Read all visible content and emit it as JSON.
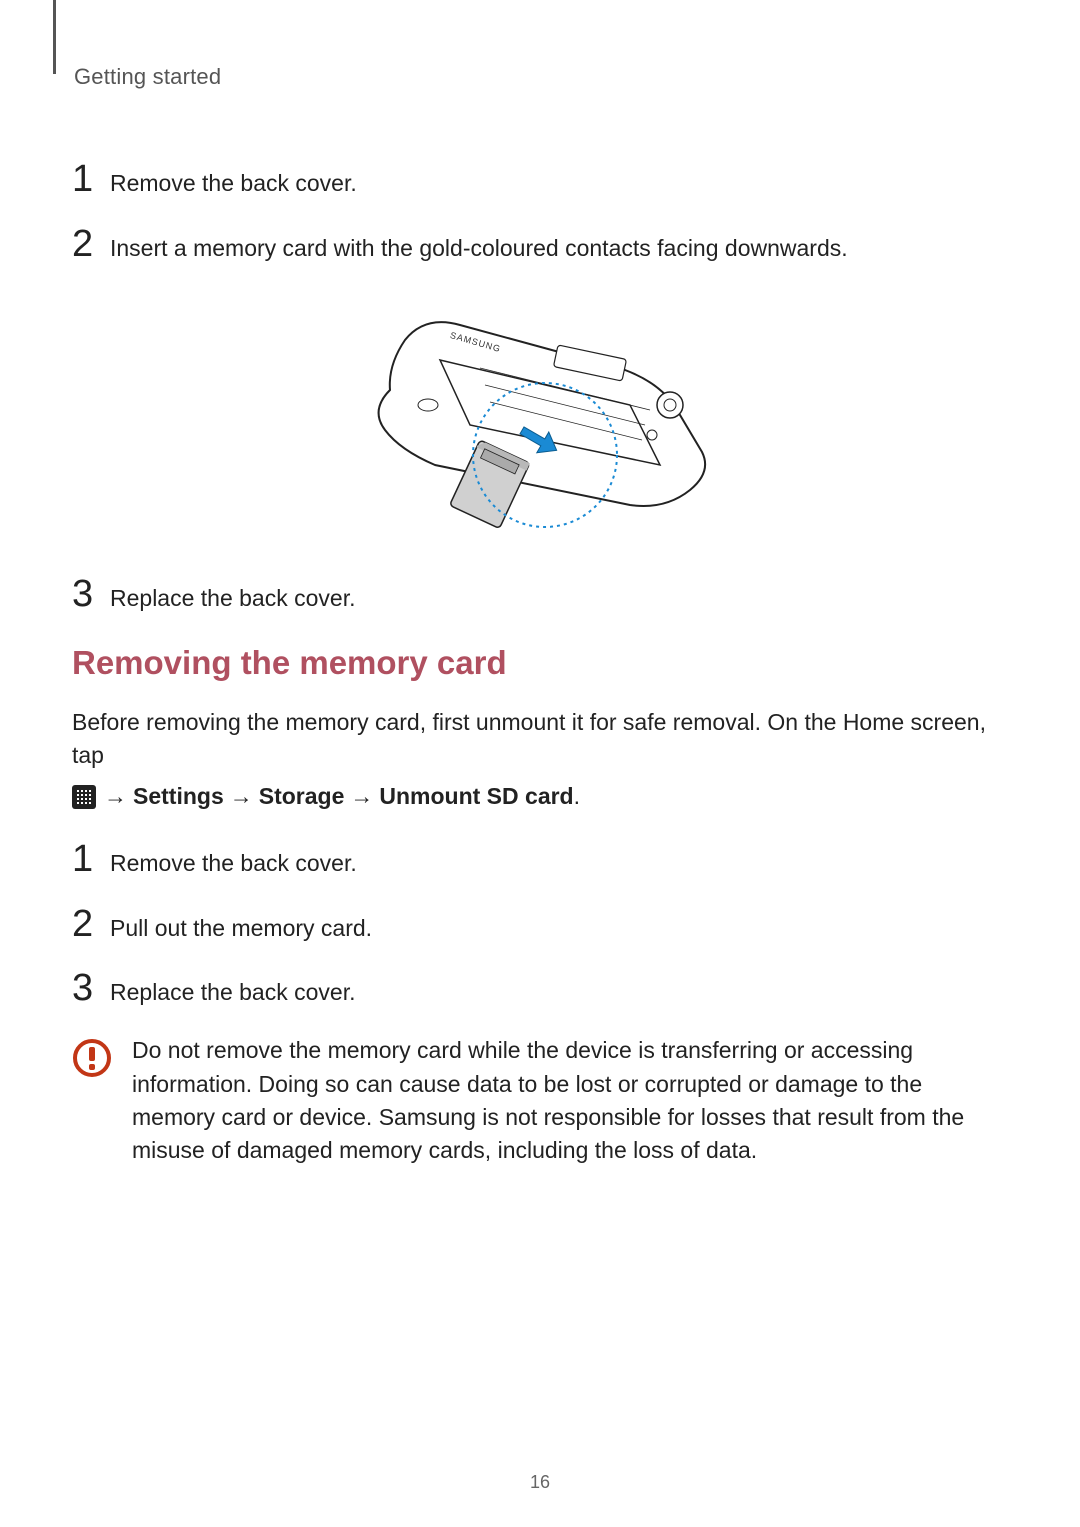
{
  "header": {
    "section": "Getting started"
  },
  "insert_steps": [
    {
      "num": "1",
      "text": "Remove the back cover."
    },
    {
      "num": "2",
      "text": "Insert a memory card with the gold-coloured contacts facing downwards."
    },
    {
      "num": "3",
      "text": "Replace the back cover."
    }
  ],
  "section_heading": "Removing the memory card",
  "intro": {
    "line1": "Before removing the memory card, first unmount it for safe removal. On the Home screen, tap",
    "arrow": "→",
    "settings": "Settings",
    "storage": "Storage",
    "unmount": "Unmount SD card",
    "period": "."
  },
  "remove_steps": [
    {
      "num": "1",
      "text": "Remove the back cover."
    },
    {
      "num": "2",
      "text": "Pull out the memory card."
    },
    {
      "num": "3",
      "text": "Replace the back cover."
    }
  ],
  "caution": "Do not remove the memory card while the device is transferring or accessing information. Doing so can cause data to be lost or corrupted or damage to the memory card or device. Samsung is not responsible for losses that result from the misuse of damaged memory cards, including the loss of data.",
  "page_number": "16"
}
